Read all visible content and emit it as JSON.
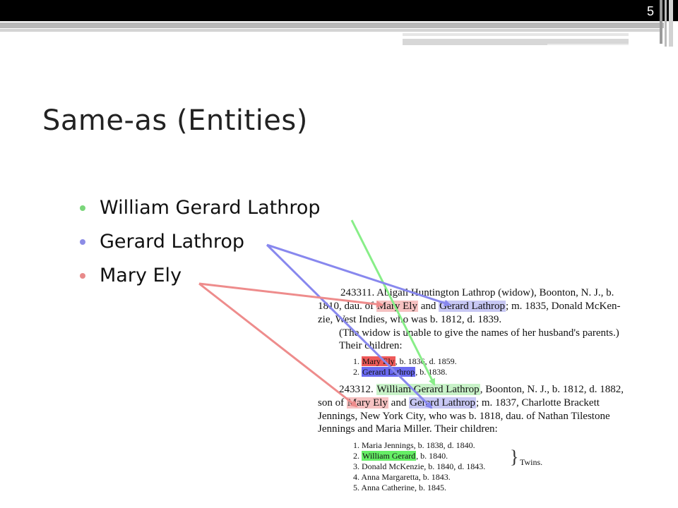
{
  "slide": {
    "page_number": "5",
    "title": "Same-as (Entities)"
  },
  "bullets": [
    {
      "text": "William Gerard Lathrop",
      "color": "#7ad67a"
    },
    {
      "text": "Gerard Lathrop",
      "color": "#8c8ce6"
    },
    {
      "text": "Mary Ely",
      "color": "#e88a8a"
    }
  ],
  "colors": {
    "green": "#88ee88",
    "blue": "#8888ee",
    "red": "#ee8c8c"
  },
  "document": {
    "e1": {
      "l1": "243311. Abigail Huntington Lathrop (widow), Boonton, N. J., b.",
      "l2a": "1810, dau. of ",
      "l2_mary": "Mary Ely",
      "l2b": " and ",
      "l2_gerard": "Gerard Lathrop",
      "l2c": "; m. 1835, Donald McKen-",
      "l3": "zie, West Indies, who was b. 1812, d. 1839.",
      "l4": "(The widow is unable to give the names of her husband's parents.)",
      "l5": "Their children:",
      "c1_num": "1. ",
      "c1_name": "Mary Ely",
      "c1_rest": ", b. 1836, d. 1859.",
      "c2_num": "2. ",
      "c2_name": "Gerard Lathrop",
      "c2_rest": ", b. 1838."
    },
    "e2": {
      "l1a": "243312. ",
      "l1_name": "William Gerard Lathrop",
      "l1b": ", Boonton, N. J., b. 1812, d. 1882,",
      "l2a": "son of ",
      "l2_mary": "Mary Ely",
      "l2b": " and ",
      "l2_gerard": "Gerard Lathrop",
      "l2c": "; m. 1837, Charlotte Brackett",
      "l3": "Jennings, New York City, who was b. 1818, dau. of Nathan Tilestone",
      "l4": "Jennings and Maria Miller. Their children:",
      "k1": "1. Maria Jennings, b. 1838, d. 1840.",
      "k2_num": "2. ",
      "k2_name": "William Gerard",
      "k2_rest": ", b. 1840.",
      "k3": "3. Donald McKenzie, b. 1840, d. 1843.",
      "k4": "4. Anna Margaretta, b. 1843.",
      "k5": "5. Anna Catherine, b. 1845.",
      "twins": "Twins."
    }
  }
}
